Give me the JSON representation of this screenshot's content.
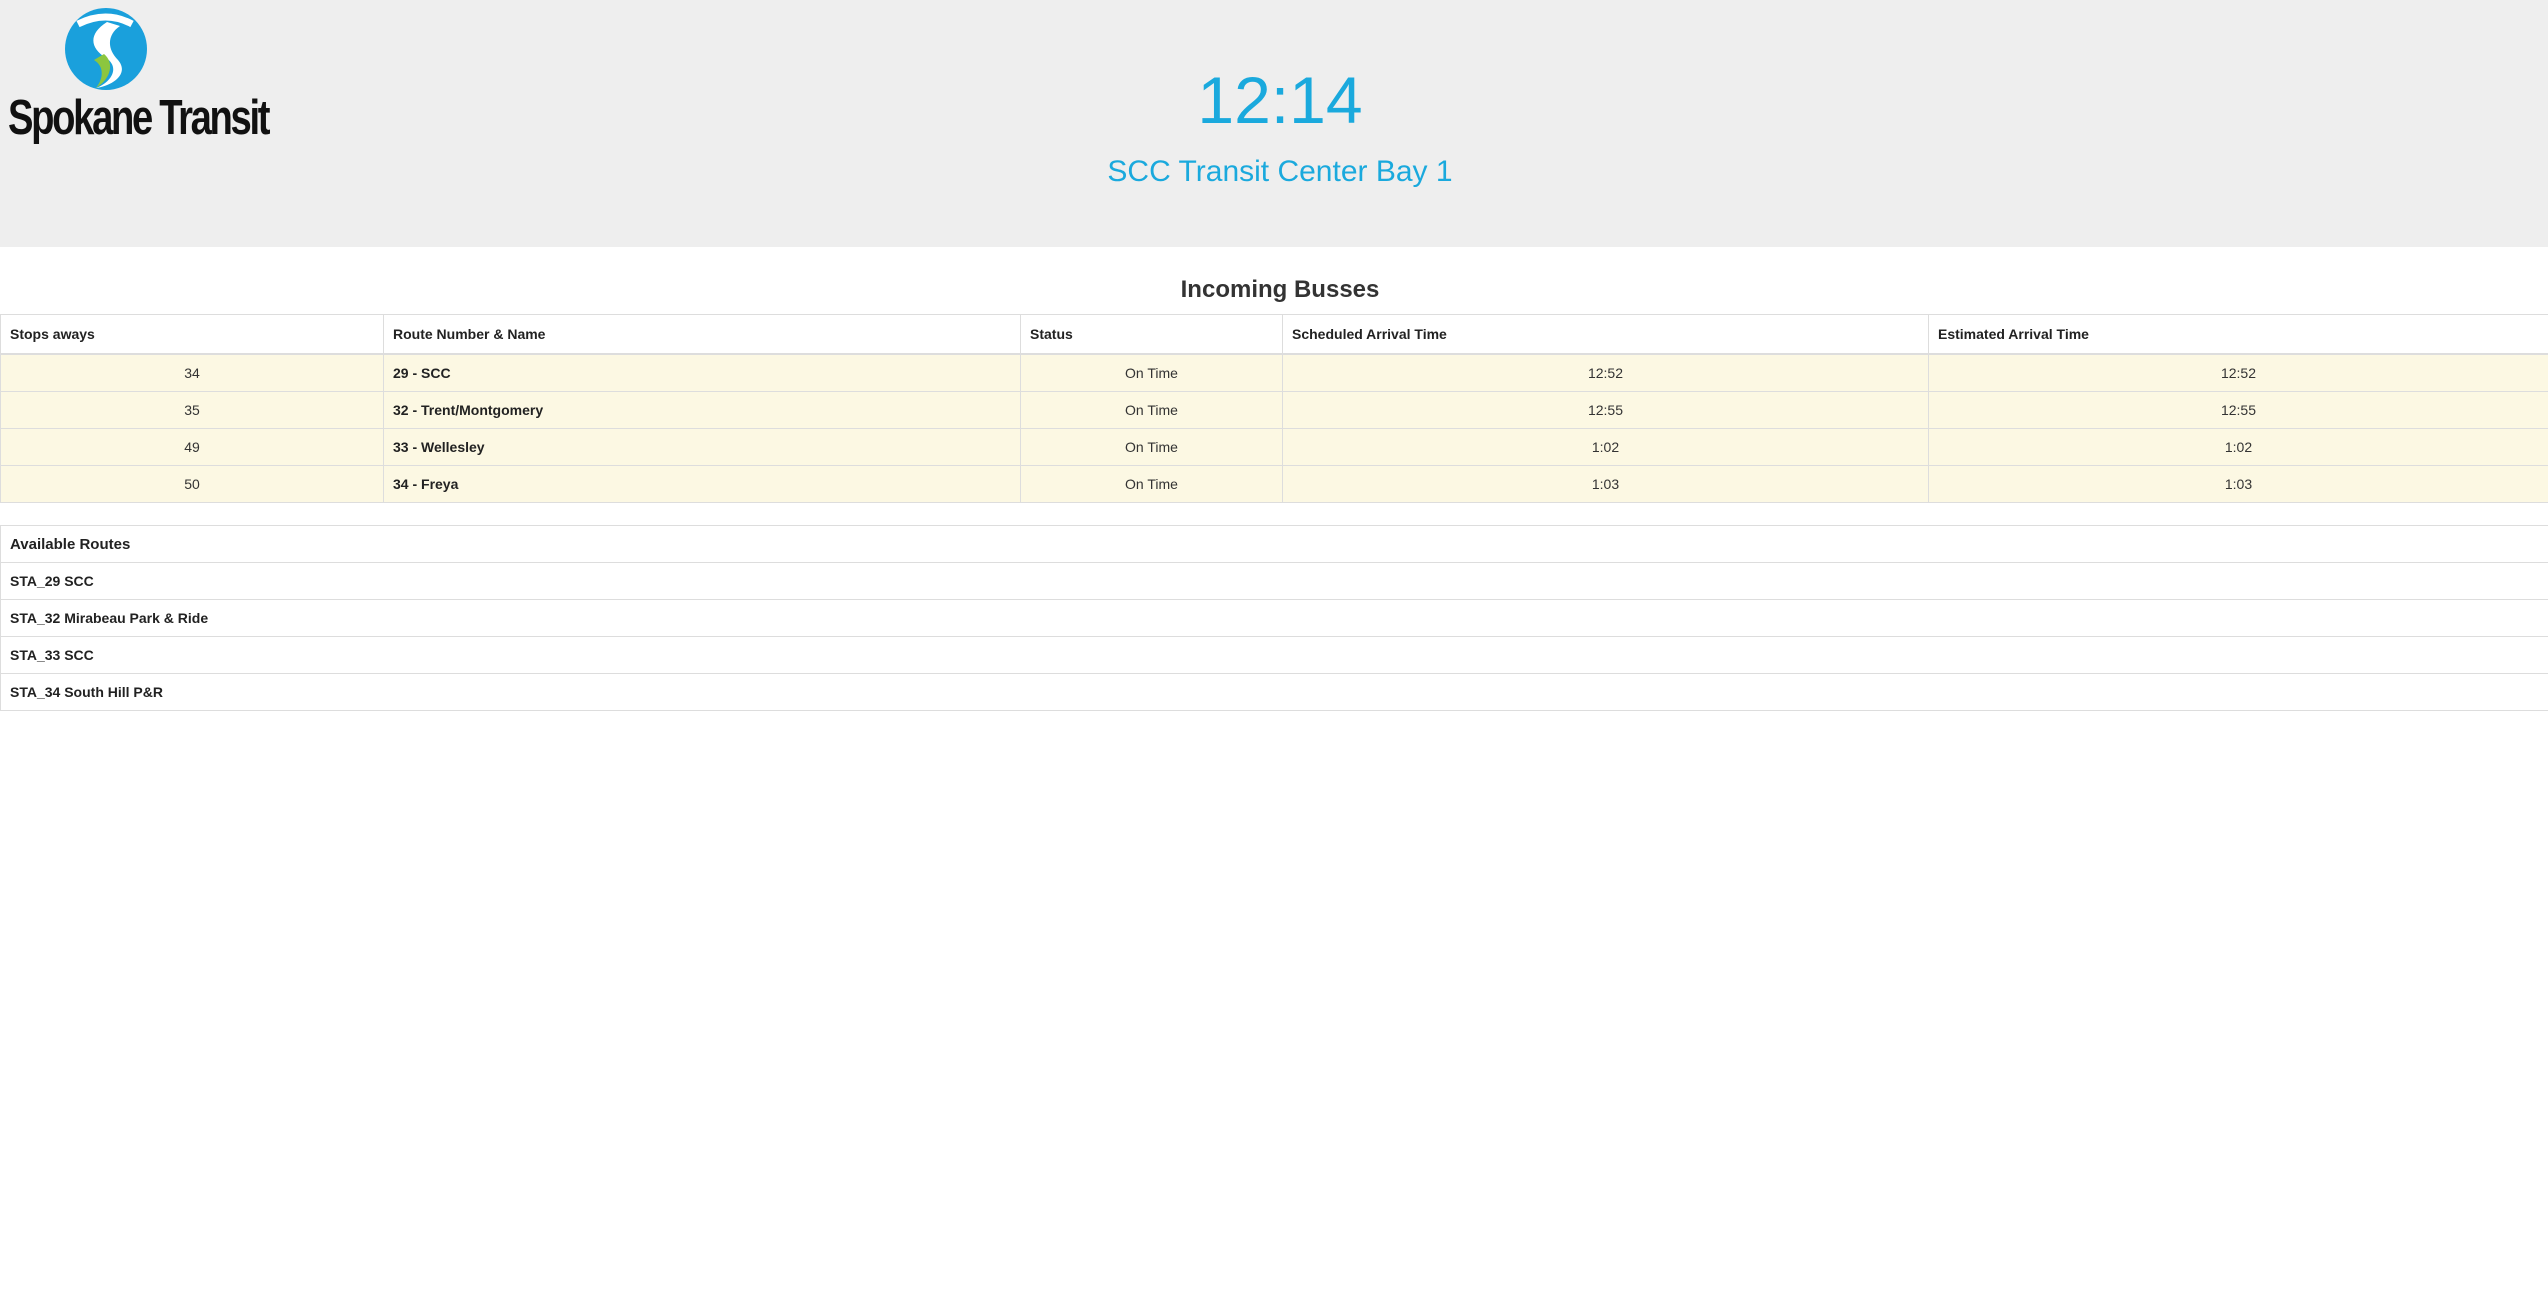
{
  "header": {
    "logo_text": "Spokane Transit",
    "clock": "12:14",
    "stop_name": "SCC Transit Center Bay 1",
    "colors": {
      "accent": "#1aa9dd",
      "logo_blue": "#1aa0dc",
      "logo_green": "#8cc63f",
      "header_bg": "#eeeeee",
      "row_highlight": "#fcf8e3"
    }
  },
  "incoming": {
    "title": "Incoming Busses",
    "columns": [
      "Stops aways",
      "Route Number & Name",
      "Status",
      "Scheduled Arrival Time",
      "Estimated Arrival Time"
    ],
    "rows": [
      {
        "stops": "34",
        "route": "29 - SCC",
        "status": "On Time",
        "scheduled": "12:52",
        "estimated": "12:52"
      },
      {
        "stops": "35",
        "route": "32 - Trent/Montgomery",
        "status": "On Time",
        "scheduled": "12:55",
        "estimated": "12:55"
      },
      {
        "stops": "49",
        "route": "33 - Wellesley",
        "status": "On Time",
        "scheduled": "1:02",
        "estimated": "1:02"
      },
      {
        "stops": "50",
        "route": "34 - Freya",
        "status": "On Time",
        "scheduled": "1:03",
        "estimated": "1:03"
      }
    ]
  },
  "routes": {
    "title": "Available Routes",
    "items": [
      "STA_29 SCC",
      "STA_32 Mirabeau Park & Ride",
      "STA_33 SCC",
      "STA_34 South Hill P&R"
    ]
  }
}
